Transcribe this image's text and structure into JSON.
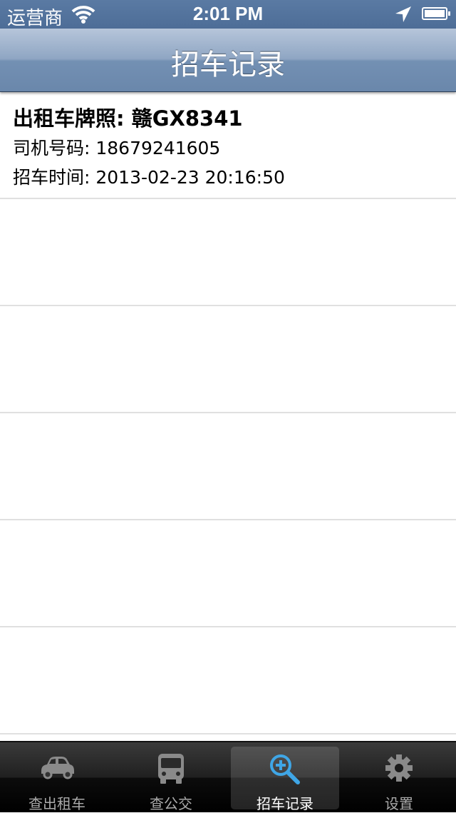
{
  "status_bar": {
    "carrier": "运营商",
    "time": "2:01 PM",
    "wifi_icon": "wifi-icon",
    "location_icon": "location-arrow-icon",
    "battery_icon": "battery-icon"
  },
  "nav": {
    "title": "招车记录"
  },
  "records": [
    {
      "plate_label": "出租车牌照: ",
      "plate_value": "赣GX8341",
      "phone_text": "司机号码: 18679241605",
      "time_text": "招车时间: 2013-02-23 20:16:50"
    }
  ],
  "tabs": [
    {
      "label": "查出租车",
      "icon": "car-icon"
    },
    {
      "label": "查公交",
      "icon": "bus-icon"
    },
    {
      "label": "招车记录",
      "icon": "magnifier-plus-icon",
      "selected": true
    },
    {
      "label": "设置",
      "icon": "gear-icon"
    }
  ],
  "colors": {
    "nav_bar": "#7390b3",
    "status_bar": "#4d6d97",
    "tab_bar": "#1a1a1a",
    "selected_icon": "#3fa6e6",
    "separator": "#e0e0e0"
  }
}
